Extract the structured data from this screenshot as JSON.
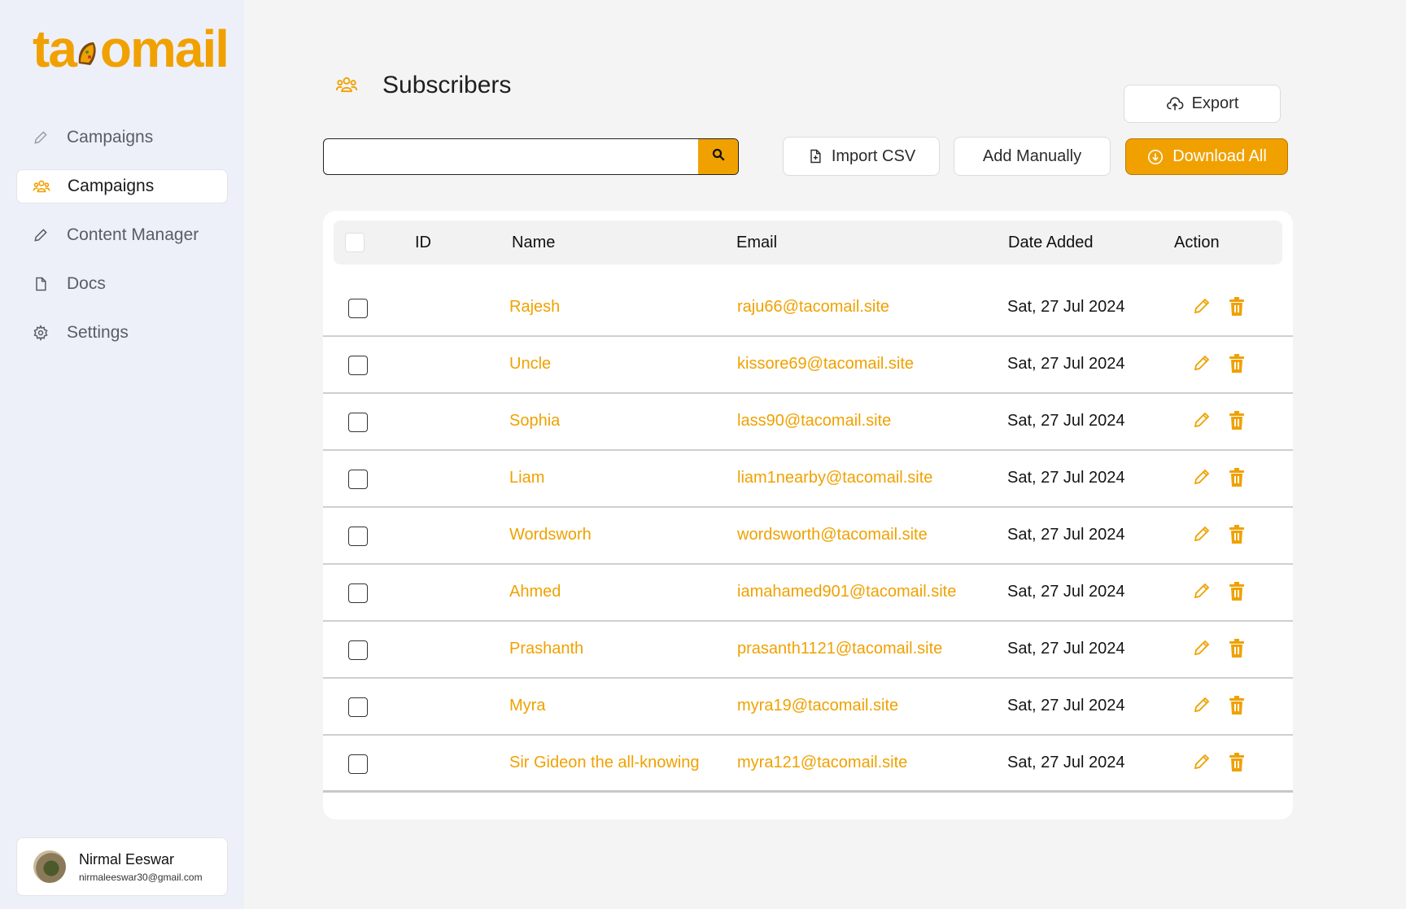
{
  "app": {
    "logo": "tacomail",
    "accent": "#f0a100"
  },
  "sidebar": {
    "items": [
      {
        "label": "Campaigns",
        "icon": "pencil-icon",
        "active": false
      },
      {
        "label": "Campaigns",
        "icon": "users-icon",
        "active": true
      },
      {
        "label": "Content Manager",
        "icon": "pencil-icon",
        "active": false
      },
      {
        "label": "Docs",
        "icon": "document-icon",
        "active": false
      },
      {
        "label": "Settings",
        "icon": "gear-icon",
        "active": false
      }
    ],
    "user": {
      "name": "Nirmal Eeswar",
      "email": "nirmaleeswar30@gmail.com"
    }
  },
  "header": {
    "title": "Subscribers",
    "icon": "users-icon"
  },
  "toolbar": {
    "export_label": "Export",
    "import_label": "Import CSV",
    "add_label": "Add Manually",
    "download_label": "Download All",
    "search_value": "",
    "search_placeholder": ""
  },
  "table": {
    "columns": {
      "id": "ID",
      "name": "Name",
      "email": "Email",
      "date": "Date Added",
      "action": "Action"
    },
    "rows": [
      {
        "id": "",
        "name": "Rajesh",
        "email": "raju66@tacomail.site",
        "date": "Sat, 27 Jul 2024"
      },
      {
        "id": "",
        "name": "Uncle",
        "email": "kissore69@tacomail.site",
        "date": "Sat, 27 Jul 2024"
      },
      {
        "id": "",
        "name": "Sophia",
        "email": "lass90@tacomail.site",
        "date": "Sat, 27 Jul 2024"
      },
      {
        "id": "",
        "name": "Liam",
        "email": "liam1nearby@tacomail.site",
        "date": "Sat, 27 Jul 2024"
      },
      {
        "id": "",
        "name": "Wordsworh",
        "email": "wordsworth@tacomail.site",
        "date": "Sat, 27 Jul 2024"
      },
      {
        "id": "",
        "name": "Ahmed",
        "email": "iamahamed901@tacomail.site",
        "date": "Sat, 27 Jul 2024"
      },
      {
        "id": "",
        "name": "Prashanth",
        "email": "prasanth1121@tacomail.site",
        "date": "Sat, 27 Jul 2024"
      },
      {
        "id": "",
        "name": "Myra",
        "email": "myra19@tacomail.site",
        "date": "Sat, 27 Jul 2024"
      },
      {
        "id": "",
        "name": "Sir Gideon the all-knowing",
        "email": "myra121@tacomail.site",
        "date": "Sat, 27 Jul 2024"
      }
    ]
  }
}
